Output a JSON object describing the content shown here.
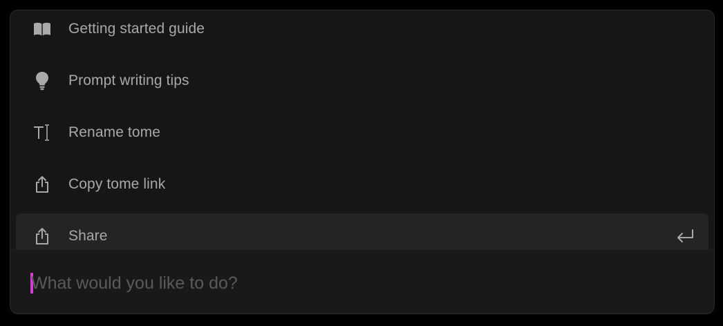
{
  "menu": {
    "items": [
      {
        "label": "Getting started guide",
        "icon": "book-icon"
      },
      {
        "label": "Prompt writing tips",
        "icon": "lightbulb-icon"
      },
      {
        "label": "Rename tome",
        "icon": "text-cursor-icon"
      },
      {
        "label": "Copy tome link",
        "icon": "share-upload-icon"
      },
      {
        "label": "Share",
        "icon": "share-upload-icon",
        "selected": true
      }
    ],
    "enter_icon": "enter-return-icon"
  },
  "command": {
    "value": "",
    "placeholder": "What would you like to do?"
  },
  "colors": {
    "background": "#000000",
    "panel": "#161616",
    "selected_row": "#242424",
    "text": "#a9a9a9",
    "placeholder": "#5a5a5a",
    "caret": "#d43fd4"
  }
}
